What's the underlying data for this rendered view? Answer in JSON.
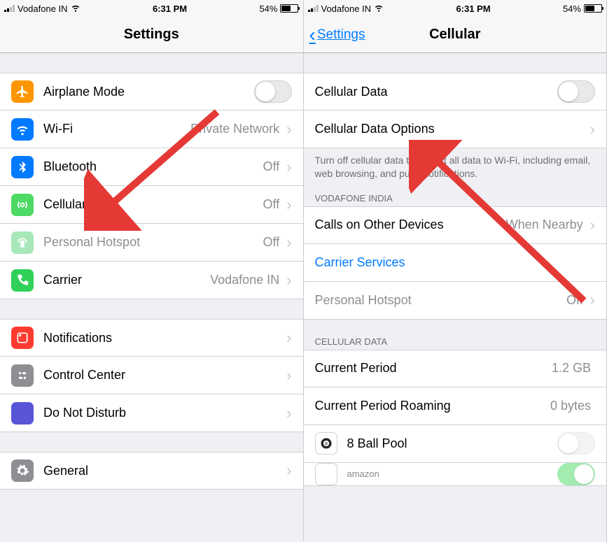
{
  "status": {
    "carrier": "Vodafone IN",
    "time": "6:31 PM",
    "battery_pct": "54%"
  },
  "left": {
    "title": "Settings",
    "rows": {
      "airplane": "Airplane Mode",
      "wifi": "Wi-Fi",
      "wifi_val": "Private Network",
      "bt": "Bluetooth",
      "bt_val": "Off",
      "cellular": "Cellular",
      "cellular_val": "Off",
      "hotspot": "Personal Hotspot",
      "hotspot_val": "Off",
      "carrier": "Carrier",
      "carrier_val": "Vodafone IN",
      "notif": "Notifications",
      "control": "Control Center",
      "dnd": "Do Not Disturb",
      "general": "General"
    }
  },
  "right": {
    "back": "Settings",
    "title": "Cellular",
    "rows": {
      "cell_data": "Cellular Data",
      "cell_opts": "Cellular Data Options",
      "note": "Turn off cellular data to restrict all data to Wi-Fi, including email, web browsing, and push notifications.",
      "sec_carrier": "VODAFONE INDIA",
      "calls_other": "Calls on Other Devices",
      "calls_other_val": "When Nearby",
      "carrier_svc": "Carrier Services",
      "hotspot": "Personal Hotspot",
      "hotspot_val": "Off",
      "sec_data": "CELLULAR DATA",
      "cur_period": "Current Period",
      "cur_period_val": "1.2 GB",
      "cur_roaming": "Current Period Roaming",
      "cur_roaming_val": "0 bytes",
      "app1": "8 Ball Pool",
      "app2": "amazon"
    }
  }
}
